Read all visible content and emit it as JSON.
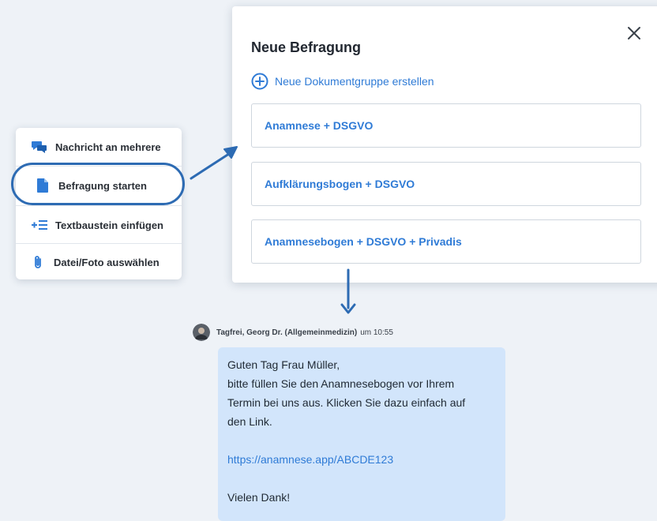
{
  "action_menu": {
    "items": [
      {
        "label": "Nachricht an mehrere",
        "icon": "chat-bubbles-icon"
      },
      {
        "label": "Befragung starten",
        "icon": "document-icon"
      },
      {
        "label": "Textbaustein einfügen",
        "icon": "plus-list-icon"
      },
      {
        "label": "Datei/Foto auswählen",
        "icon": "paperclip-icon"
      }
    ]
  },
  "modal": {
    "title": "Neue Befragung",
    "close_icon": "close-icon",
    "new_group_label": "Neue Dokumentgruppe erstellen",
    "options": [
      {
        "label": "Anamnese + DSGVO"
      },
      {
        "label": "Aufklärungsbogen + DSGVO"
      },
      {
        "label": "Anamnesebogen + DSGVO + Privadis"
      }
    ]
  },
  "message": {
    "sender": "Tagfrei, Georg Dr. (Allgemeinmedizin)",
    "time": "um 10:55",
    "lines": [
      "Guten Tag Frau Müller,",
      "bitte füllen Sie den Anamnesebogen vor Ihrem",
      "Termin bei uns aus. Klicken Sie dazu einfach auf",
      "den Link."
    ],
    "link": "https://anamnese.app/ABCDE123",
    "closing": "Vielen Dank!"
  },
  "colors": {
    "accent_blue": "#2f7bd6",
    "highlight_ring": "#2d6bb3",
    "bubble_bg": "#d2e5fb",
    "page_bg": "#eef2f7"
  }
}
